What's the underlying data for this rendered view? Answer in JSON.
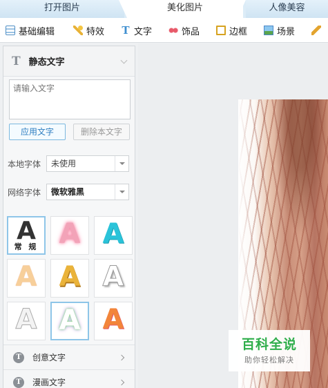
{
  "tabs": [
    {
      "label": "打开图片"
    },
    {
      "label": "美化图片"
    },
    {
      "label": "人像美容"
    }
  ],
  "toolbar": [
    {
      "label": "基础编辑",
      "icon": "basic-edit-icon"
    },
    {
      "label": "特效",
      "icon": "magic-wand-icon"
    },
    {
      "label": "文字",
      "icon": "text-icon"
    },
    {
      "label": "饰品",
      "icon": "bow-icon"
    },
    {
      "label": "边框",
      "icon": "frame-icon"
    },
    {
      "label": "场景",
      "icon": "scene-icon"
    },
    {
      "label": "",
      "icon": "pen-icon"
    }
  ],
  "panel": {
    "title": "静态文字",
    "text_placeholder": "请输入文字",
    "apply_label": "应用文字",
    "delete_label": "删除本文字",
    "local_font_label": "本地字体",
    "local_font_value": "未使用",
    "web_font_label": "网络字体",
    "web_font_value": "微软雅黑",
    "styles": [
      {
        "glyph": "A",
        "caption": "常 规"
      },
      {
        "glyph": "A"
      },
      {
        "glyph": "A"
      },
      {
        "glyph": "A"
      },
      {
        "glyph": "A"
      },
      {
        "glyph": "A"
      },
      {
        "glyph": "A"
      },
      {
        "glyph": "A"
      },
      {
        "glyph": "A"
      }
    ],
    "categories": [
      {
        "label": "创意文字"
      },
      {
        "label": "漫画文字"
      }
    ]
  },
  "watermark": {
    "title": "百科全说",
    "subtitle": "助你轻松解决"
  },
  "colors": {
    "accent": "#2f7fc1",
    "tab_bg": "#dcecf7",
    "watermark_green": "#2fae4b"
  }
}
